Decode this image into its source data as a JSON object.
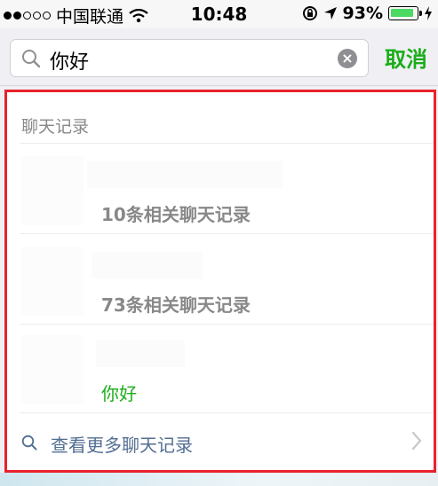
{
  "status_bar": {
    "carrier": "中国联通",
    "time": "10:48",
    "battery_percent": "93%",
    "battery_level": 0.93,
    "battery_color": "#4cd964"
  },
  "search": {
    "query": "你好",
    "cancel_label": "取消",
    "accent_color": "#1aad19"
  },
  "results": {
    "section_title": "聊天记录",
    "items": [
      {
        "subtitle": "10条相关聊天记录"
      },
      {
        "subtitle": "73条相关聊天记录"
      },
      {
        "subtitle": "你好"
      }
    ],
    "more_label": "查看更多聊天记录",
    "highlight_border_color": "#e8222c"
  }
}
